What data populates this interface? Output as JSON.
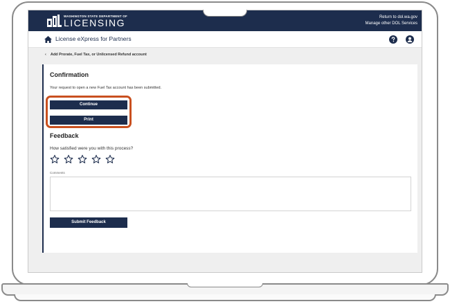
{
  "header": {
    "logo_small": "WASHINGTON STATE DEPARTMENT OF",
    "logo_big": "LICENSING",
    "links": [
      "Return to dol.wa.gov",
      "Manage other DOL Services"
    ]
  },
  "appbar": {
    "title": "License eXpress for Partners"
  },
  "breadcrumb": {
    "label": "Add Prorate, Fuel Tax, or Unlicensed Refund account"
  },
  "confirmation": {
    "title": "Confirmation",
    "message": "Your request to open a new Fuel Tax account has been submitted.",
    "continue_label": "Continue",
    "print_label": "Print"
  },
  "feedback": {
    "title": "Feedback",
    "question": "How satisfied were you with this process?",
    "rating_max": 5,
    "rating_value": 0,
    "comments_label": "Comments",
    "comments_value": "",
    "submit_label": "Submit Feedback"
  },
  "colors": {
    "navy": "#1d2d4d",
    "highlight": "#c9501f"
  }
}
